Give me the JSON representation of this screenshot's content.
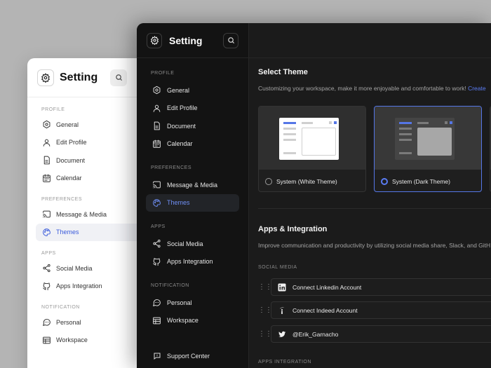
{
  "light": {
    "title": "Setting",
    "sections": [
      {
        "label": "PROFILE",
        "items": [
          {
            "label": "General",
            "icon": "gear-icon"
          },
          {
            "label": "Edit Profile",
            "icon": "user-icon"
          },
          {
            "label": "Document",
            "icon": "document-icon"
          },
          {
            "label": "Calendar",
            "icon": "calendar-icon"
          }
        ]
      },
      {
        "label": "PREFERENCES",
        "items": [
          {
            "label": "Message & Media",
            "icon": "cast-icon"
          },
          {
            "label": "Themes",
            "icon": "palette-icon",
            "active": true
          }
        ]
      },
      {
        "label": "APPS",
        "items": [
          {
            "label": "Social Media",
            "icon": "share-icon"
          },
          {
            "label": "Apps Integration",
            "icon": "github-icon"
          }
        ]
      },
      {
        "label": "NOTIFICATION",
        "items": [
          {
            "label": "Personal",
            "icon": "chat-icon"
          },
          {
            "label": "Workspace",
            "icon": "workspace-icon"
          }
        ]
      }
    ]
  },
  "dark": {
    "title": "Setting",
    "sections": [
      {
        "label": "PROFILE",
        "items": [
          {
            "label": "General",
            "icon": "gear-icon"
          },
          {
            "label": "Edit Profile",
            "icon": "user-icon"
          },
          {
            "label": "Document",
            "icon": "document-icon"
          },
          {
            "label": "Calendar",
            "icon": "calendar-icon"
          }
        ]
      },
      {
        "label": "PREFERENCES",
        "items": [
          {
            "label": "Message & Media",
            "icon": "cast-icon"
          },
          {
            "label": "Themes",
            "icon": "palette-icon",
            "active": true
          }
        ]
      },
      {
        "label": "APPS",
        "items": [
          {
            "label": "Social Media",
            "icon": "share-icon"
          },
          {
            "label": "Apps Integration",
            "icon": "github-icon"
          }
        ]
      },
      {
        "label": "NOTIFICATION",
        "items": [
          {
            "label": "Personal",
            "icon": "chat-icon"
          },
          {
            "label": "Workspace",
            "icon": "workspace-icon"
          }
        ]
      }
    ],
    "support": "Support Center"
  },
  "main": {
    "theme_title": "Select Theme",
    "theme_desc": "Customizing your workspace, make it more enjoyable and comfortable to work!",
    "theme_desc_link": "Create",
    "themes": [
      {
        "label": "System (White Theme)",
        "selected": false
      },
      {
        "label": "System (Dark Theme)",
        "selected": true
      }
    ],
    "apps_title": "Apps & Integration",
    "apps_desc": "Improve communication and productivity by utilizing social media share, Slack, and GitH",
    "social_label": "SOCIAL MEDIA",
    "social": [
      {
        "label": "Connect Linkedin Account",
        "icon": "linkedin-icon"
      },
      {
        "label": "Connect Indeed Account",
        "icon": "indeed-icon"
      },
      {
        "label": "@Erik_Garnacho",
        "icon": "twitter-icon"
      }
    ],
    "integration_label": "APPS INTEGRATION"
  },
  "colors": {
    "accent": "#5b7cf4",
    "dark_bg": "#1b1b1b",
    "sidebar_bg": "#131313"
  }
}
